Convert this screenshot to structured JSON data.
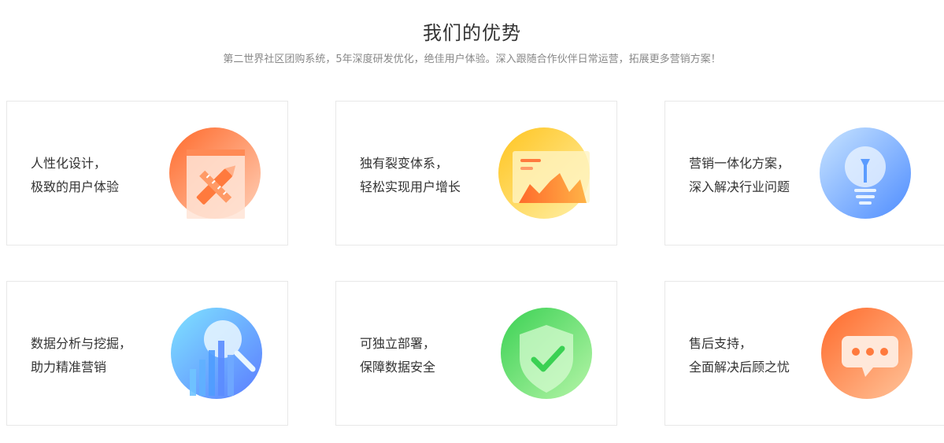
{
  "section": {
    "title": "我们的优势",
    "subtitle": "第二世界社区团购系统，5年深度研发优化，绝佳用户体验。深入跟随合作伙伴日常运营，拓展更多营销方案！"
  },
  "cards": [
    {
      "line1": "人性化设计，",
      "line2": "极致的用户体验",
      "icon": "design-pencil-ruler-icon",
      "color": "#ff7a3d"
    },
    {
      "line1": "独有裂变体系，",
      "line2": "轻松实现用户增长",
      "icon": "growth-chart-icon",
      "color": "#ffc53d"
    },
    {
      "line1": "营销一体化方案，",
      "line2": "深入解决行业问题",
      "icon": "lightbulb-icon",
      "color": "#5b9cff"
    },
    {
      "line1": "数据分析与挖掘，",
      "line2": "助力精准营销",
      "icon": "data-magnifier-icon",
      "color": "#4fb8ff"
    },
    {
      "line1": "可独立部署，",
      "line2": "保障数据安全",
      "icon": "security-shield-icon",
      "color": "#52d96a"
    },
    {
      "line1": "售后支持，",
      "line2": "全面解决后顾之忧",
      "icon": "chat-bubble-icon",
      "color": "#ff7a3d"
    }
  ]
}
